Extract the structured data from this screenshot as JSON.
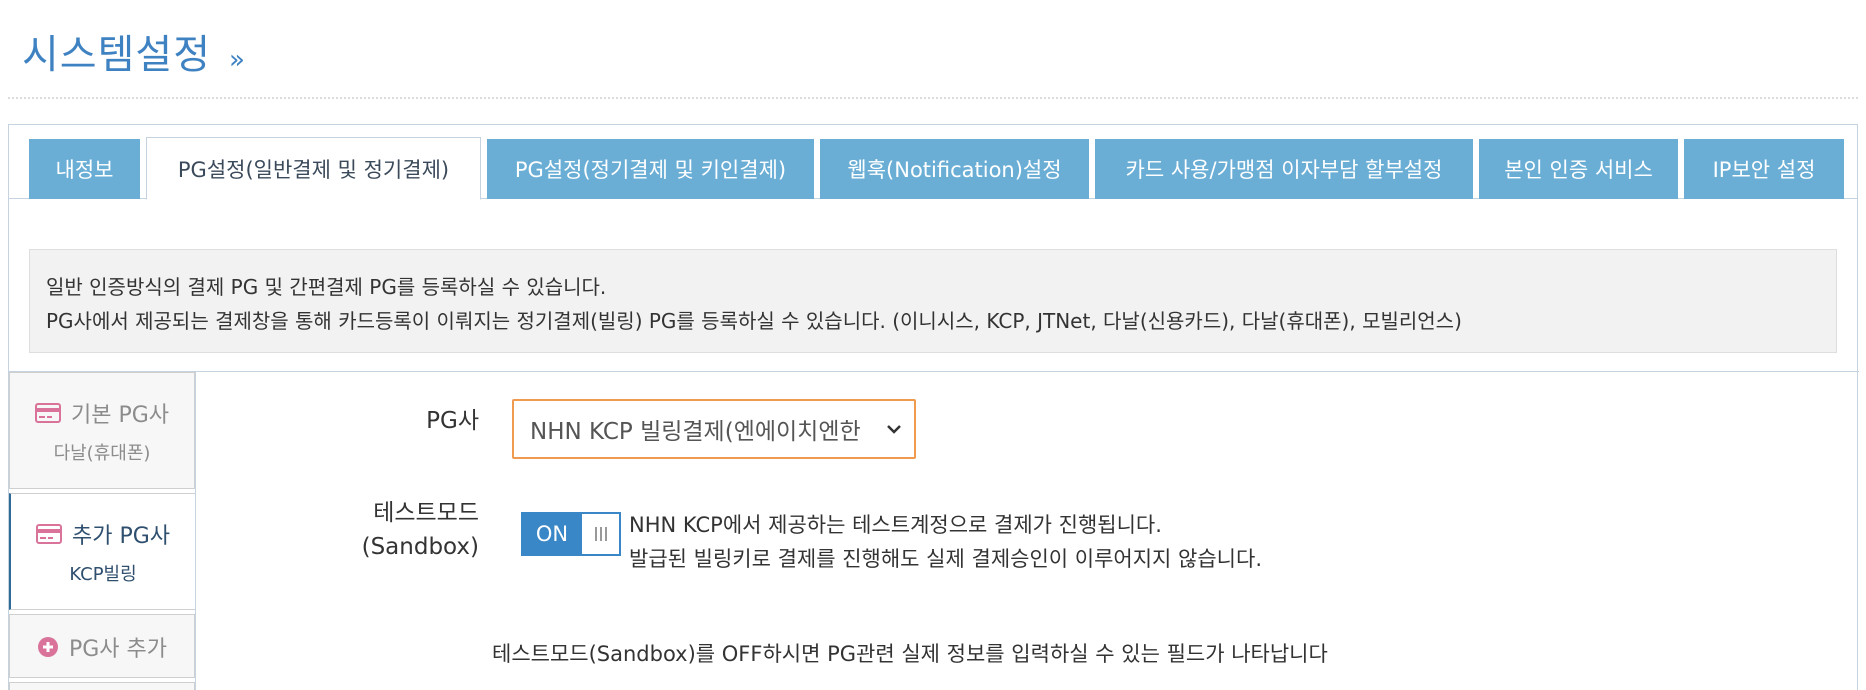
{
  "page": {
    "title": "시스템설정",
    "title_chevron": "»"
  },
  "tabs": [
    {
      "label": "내정보",
      "active": false
    },
    {
      "label": "PG설정(일반결제 및 정기결제)",
      "active": true
    },
    {
      "label": "PG설정(정기결제 및 키인결제)",
      "active": false
    },
    {
      "label": "웹훅(Notification)설정",
      "active": false
    },
    {
      "label": "카드 사용/가맹점 이자부담 할부설정",
      "active": false
    },
    {
      "label": "본인 인증 서비스",
      "active": false
    },
    {
      "label": "IP보안 설정",
      "active": false
    }
  ],
  "info": {
    "line1": "일반 인증방식의 결제 PG 및 간편결제 PG를 등록하실 수 있습니다.",
    "line2": "PG사에서 제공되는 결제창을 통해 카드등록이 이뤄지는 정기결제(빌링) PG를 등록하실 수 있습니다. (이니시스, KCP, JTNet, 다날(신용카드), 다날(휴대폰), 모빌리언스)"
  },
  "sidebar": {
    "items": [
      {
        "title": "기본 PG사",
        "sub": "다날(휴대폰)",
        "icon": "credit-card-icon",
        "active": false
      },
      {
        "title": "추가 PG사",
        "sub": "KCP빌링",
        "icon": "credit-card-icon",
        "active": true
      },
      {
        "title": "PG사 추가",
        "icon": "plus-circle-icon",
        "active": false
      }
    ]
  },
  "form": {
    "pg_label": "PG사",
    "pg_value": "NHN KCP 빌링결제(엔에이치엔한",
    "testmode_label_1": "테스트모드",
    "testmode_label_2": "(Sandbox)",
    "toggle_state": "ON",
    "desc_line1": "NHN KCP에서 제공하는 테스트계정으로 결제가 진행됩니다.",
    "desc_line2": "발급된 빌링키로 결제를 진행해도 실제 결제승인이 이루어지지 않습니다.",
    "note": "테스트모드(Sandbox)를 OFF하시면 PG관련 실제 정보를 입력하실 수 있는 필드가 나타납니다"
  },
  "colors": {
    "accent": "#3f82c2",
    "tab_bg": "#6aaed6",
    "select_border": "#ef9a4f",
    "toggle_on": "#3a87c8",
    "icon_pink": "#d9739a"
  }
}
